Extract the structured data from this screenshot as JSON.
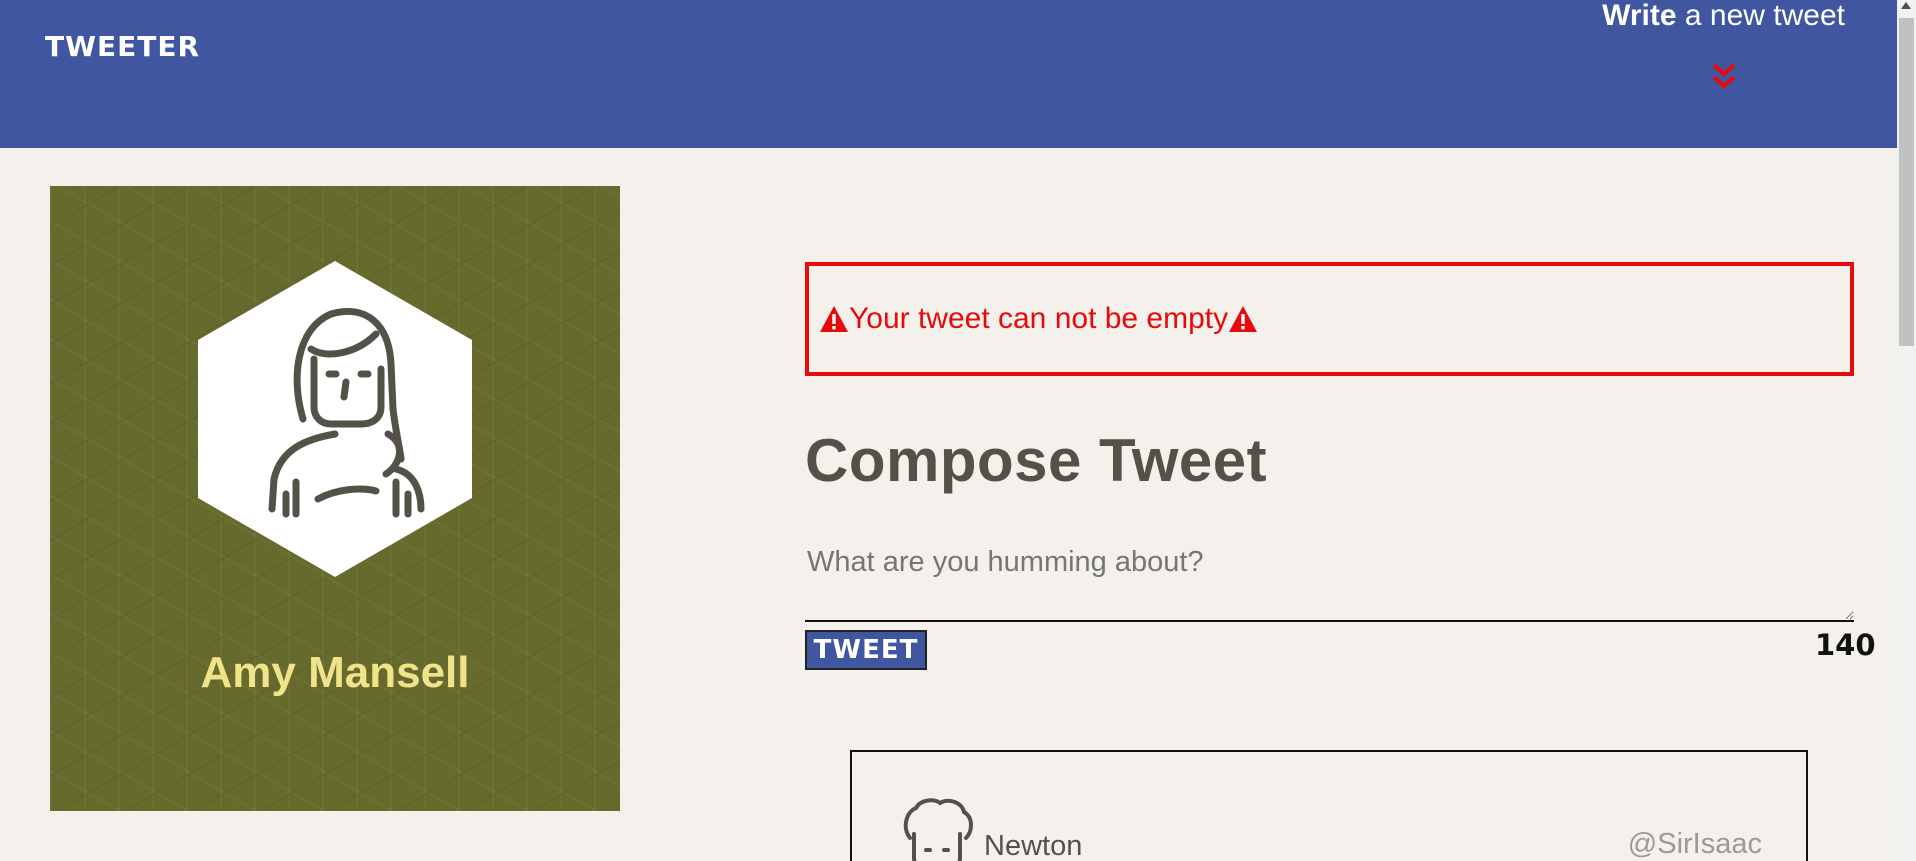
{
  "navbar": {
    "brand": "TWEETER",
    "write_bold": "Write",
    "write_rest": " a new tweet",
    "toggle_icon": "double-chevron-down-icon",
    "accent_color": "#e8090a",
    "background_color": "#4056a1"
  },
  "profile": {
    "name": "Amy Mansell",
    "avatar_icon": "woman-avatar-icon",
    "background_color": "#676a2d",
    "name_color": "#f1e38a"
  },
  "compose": {
    "error_message": "Your tweet can not be empty",
    "error_icon": "warning-icon",
    "title": "Compose Tweet",
    "placeholder": "What are you humming about?",
    "value": "",
    "button_label": "TWEET",
    "counter": "140"
  },
  "tweets": [
    {
      "name": "Newton",
      "handle": "@SirIsaac",
      "avatar_icon": "man-avatar-icon"
    }
  ]
}
